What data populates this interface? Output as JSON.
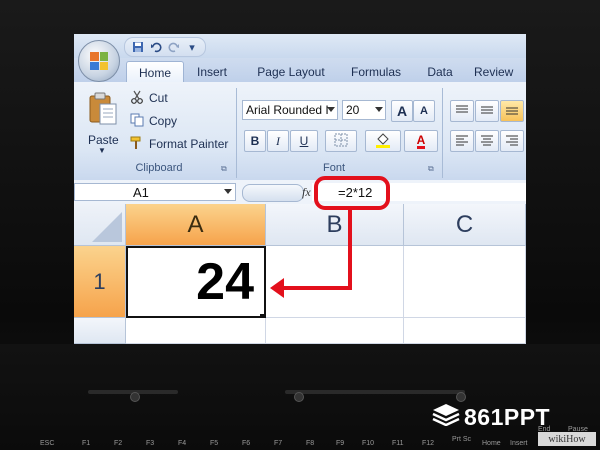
{
  "qat_icons": [
    "save-icon",
    "undo-icon",
    "redo-icon",
    "customize-icon"
  ],
  "tabs": [
    {
      "label": "Home",
      "active": true
    },
    {
      "label": "Insert",
      "active": false
    },
    {
      "label": "Page Layout",
      "active": false
    },
    {
      "label": "Formulas",
      "active": false
    },
    {
      "label": "Data",
      "active": false
    },
    {
      "label": "Review",
      "active": false
    }
  ],
  "clipboard": {
    "paste_label": "Paste",
    "cut_label": "Cut",
    "copy_label": "Copy",
    "format_painter_label": "Format Painter",
    "group_label": "Clipboard"
  },
  "font": {
    "family": "Arial Rounded I",
    "size": "20",
    "bold_label": "B",
    "italic_label": "I",
    "underline_label": "U",
    "grow_label": "A",
    "shrink_label": "A",
    "font_color_label": "A",
    "group_label": "Font"
  },
  "formula_bar": {
    "name_box": "A1",
    "fx_label": "fx",
    "formula": "=2*12"
  },
  "sheet": {
    "columns": [
      "A",
      "B",
      "C"
    ],
    "rows": [
      "1"
    ],
    "cell_a1": "24"
  },
  "keyboard": [
    "ESC",
    "F1",
    "F2",
    "F3",
    "F4",
    "F5",
    "F6",
    "F7",
    "F8",
    "F9",
    "F10",
    "F11",
    "F12",
    "Prt Sc",
    "Home",
    "Insert",
    "End",
    "Pause"
  ],
  "watermark": "861PPT",
  "wikihow": "wikiHow",
  "colors": {
    "selected_header": "#f6a34b",
    "annotation_red": "#e3101c",
    "ribbon_bg": "#dbe6f4"
  }
}
